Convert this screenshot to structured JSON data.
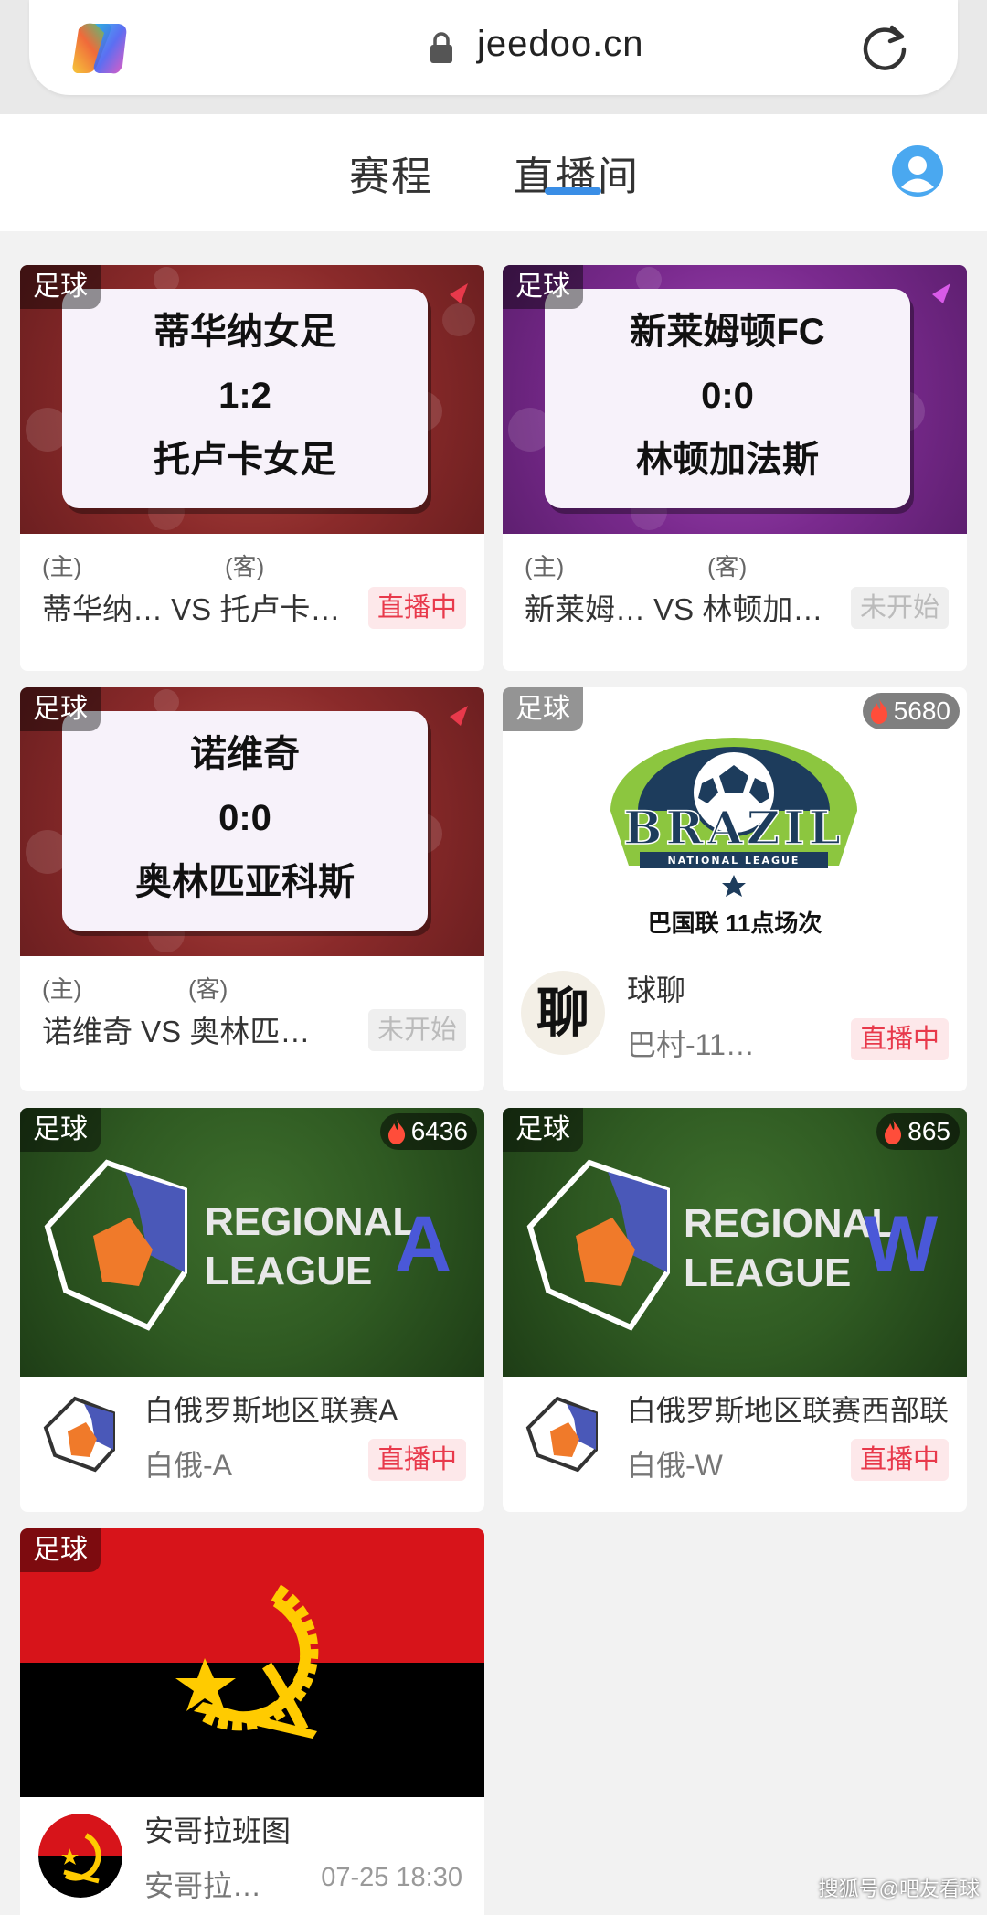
{
  "browser": {
    "url": "jeedoo.cn"
  },
  "nav": {
    "tabs": [
      "赛程",
      "直播间"
    ]
  },
  "cards": [
    {
      "tag": "足球",
      "home_team": "蒂华纳女足",
      "score": "1:2",
      "away_team": "托卢卡女足",
      "home_label": "(主)",
      "away_label": "(客)",
      "match": "蒂华纳… VS 托卢卡…",
      "status": "直播中",
      "theme_color": "#8a2a2a"
    },
    {
      "tag": "足球",
      "home_team": "新莱姆顿FC",
      "score": "0:0",
      "away_team": "林顿加法斯",
      "home_label": "(主)",
      "away_label": "(客)",
      "match": "新莱姆… VS 林顿加…",
      "status": "未开始",
      "theme_color": "#7a2a8e"
    },
    {
      "tag": "足球",
      "home_team": "诺维奇",
      "score": "0:0",
      "away_team": "奥林匹亚科斯",
      "home_label": "(主)",
      "away_label": "(客)",
      "match": "诺维奇 VS 奥林匹…",
      "status": "未开始",
      "theme_color": "#8a2a2a"
    },
    {
      "tag": "足球",
      "viewers": "5680",
      "logo_text": "BRAZIL",
      "logo_sub": "NATIONAL LEAGUE",
      "caption": "巴国联 11点场次",
      "avatar_char": "聊",
      "title": "球聊",
      "subtitle": "巴村-11…",
      "status": "直播中"
    },
    {
      "tag": "足球",
      "viewers": "6436",
      "logo_line1": "REGIONAL",
      "logo_line2": "LEAGUE",
      "logo_letter": "A",
      "title": "白俄罗斯地区联赛A",
      "subtitle": "白俄-A",
      "status": "直播中"
    },
    {
      "tag": "足球",
      "viewers": "865",
      "logo_line1": "REGIONAL",
      "logo_line2": "LEAGUE",
      "logo_letter": "W",
      "title": "白俄罗斯地区联赛西部联",
      "subtitle": "白俄-W",
      "status": "直播中"
    },
    {
      "tag": "足球",
      "title": "安哥拉班图",
      "subtitle": "安哥拉…",
      "time": "07-25 18:30"
    }
  ],
  "watermark": "搜狐号@吧友看球",
  "colors": {
    "live": "#e8394b",
    "accent": "#3a8ee6",
    "grass": "#2f5a22",
    "angola_red": "#d7141a"
  }
}
